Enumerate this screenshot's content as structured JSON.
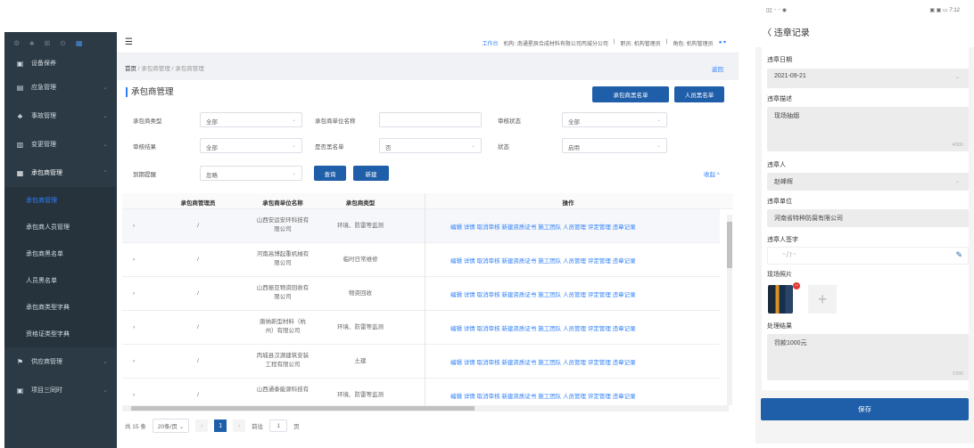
{
  "sidebar": {
    "items": [
      {
        "label": "设备保养",
        "icon": "▣"
      },
      {
        "label": "应急管理",
        "icon": "▤"
      },
      {
        "label": "事故管理",
        "icon": "♣"
      },
      {
        "label": "变更管理",
        "icon": "▥"
      },
      {
        "label": "承包商管理",
        "icon": "▦"
      }
    ],
    "subitems": [
      "承包商管理",
      "承包商人员管理",
      "承包商黑名单",
      "人员黑名单",
      "承包商类型字典",
      "资格证类型字典"
    ],
    "bottom": [
      {
        "label": "供应商管理",
        "icon": "⚑"
      },
      {
        "label": "项目三同时",
        "icon": "▣"
      }
    ]
  },
  "topbar": {
    "workbench": "工作台",
    "org": "机构: 南通星辰合成材料有限公司丙城分公司",
    "sep": "|",
    "position": "职员: 机构管理员",
    "role": "角色: 机构管理员"
  },
  "breadcrumb": {
    "home": "首页",
    "mid": "承包商管理",
    "cur": "承包商管理",
    "back": "返回"
  },
  "page": {
    "title": "承包商管理",
    "btn_blacklist": "承包商黑名单",
    "btn_people_blacklist": "人员黑名单"
  },
  "filters": {
    "type_label": "承包商类型",
    "type_value": "全部",
    "name_label": "承包商单位名称",
    "name_value": "",
    "audit_status_label": "审核状态",
    "audit_status_value": "全部",
    "audit_result_label": "审核结果",
    "audit_result_value": "全部",
    "blacklist_label": "是否黑名单",
    "blacklist_value": "否",
    "state_label": "状态",
    "state_value": "启用",
    "expire_label": "到期提醒",
    "expire_value": "忽略",
    "query": "查询",
    "new": "新建",
    "collapse": "收起 ^"
  },
  "table": {
    "headers": {
      "admin": "承包商管理员",
      "name": "承包商单位名称",
      "type": "承包商类型",
      "ops": "操作"
    },
    "rows": [
      {
        "admin": "/",
        "name1": "山西安运安环科技有",
        "name2": "限公司",
        "type": "环境、防雷等监测"
      },
      {
        "admin": "/",
        "name1": "河南高博起重机械有",
        "name2": "限公司",
        "type": "临时日常维修"
      },
      {
        "admin": "/",
        "name1": "山西振亚物资回收有",
        "name2": "限公司",
        "type": "物资回收"
      },
      {
        "admin": "/",
        "name1": "唐纳新型材料（杭",
        "name2": "州）有限公司",
        "type": "环境、防雷等监测"
      },
      {
        "admin": "/",
        "name1": "丙城县汉源建筑安装",
        "name2": "工程有限公司",
        "type": "土建"
      },
      {
        "admin": "/",
        "name1": "山西通泰能源科技有",
        "name2": "",
        "type": "环境、防雷等监测"
      }
    ],
    "ops": "编辑 详情 取消审核 新建资质证书 施工团队 人员管理 评定管理 违章记录"
  },
  "pager": {
    "total": "共 15 条",
    "size": "20条/页",
    "page": "1",
    "goto": "前往",
    "goto_value": "1",
    "page_unit": "页"
  },
  "phone": {
    "status_left": "▯▯ ᐧᐧ ᐧᐧ ◉",
    "status_right": "▣ ▣ ▭ 7:12",
    "title": "〈  违章记录",
    "date_label": "违章日期",
    "date_value": "2021-09-21",
    "desc_label": "违章描述",
    "desc_value": "现场抽烟",
    "desc_count": "4/200",
    "person_label": "违章人",
    "person_value": "赵峰辉",
    "unit_label": "违章单位",
    "unit_value": "河南省特种防腐有限公司",
    "sign_label": "违章人签字",
    "photo_label": "现场照片",
    "result_label": "处理结果",
    "result_value": "罚款1000元",
    "result_count": "7/200",
    "save": "保存"
  }
}
